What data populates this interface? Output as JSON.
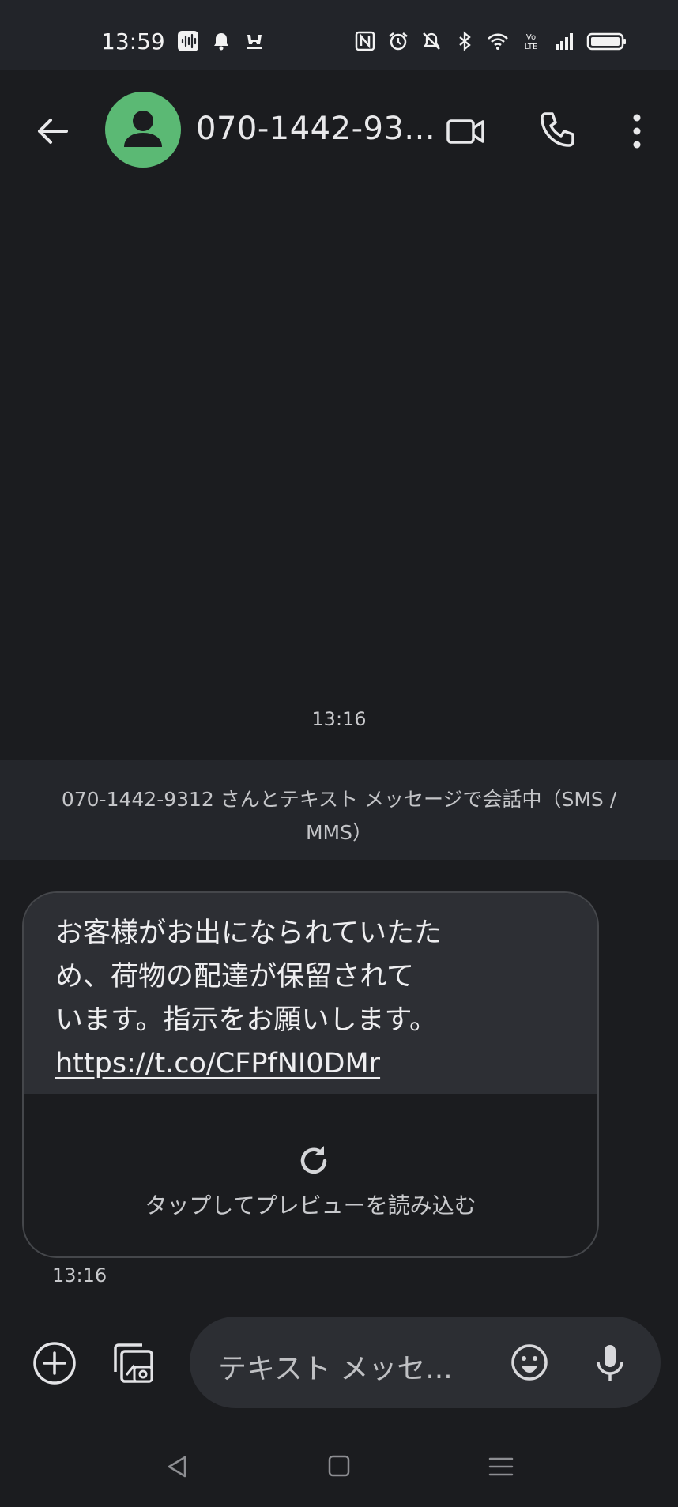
{
  "status_bar": {
    "time": "13:59",
    "left_icons": [
      "audio-app-icon",
      "notification-bell-icon",
      "honda-icon"
    ],
    "right_icons": [
      "nfc-icon",
      "alarm-icon",
      "mute-icon",
      "bluetooth-icon",
      "wifi-icon",
      "volte-icon",
      "signal-icon",
      "battery-icon"
    ]
  },
  "app_bar": {
    "contact_name": "070-1442-93...",
    "avatar_color": "#5bb974",
    "actions": [
      "video-call-icon",
      "phone-call-icon",
      "more-vert-icon"
    ]
  },
  "conversation": {
    "timestamp": "13:16",
    "sms_banner_lines": [
      "070-1442-9312 さんとテキスト メッセージで会話中（SMS /",
      "MMS）"
    ],
    "message": {
      "lines": [
        "お客様がお出になられていたた",
        "め、荷物の配達が保留されて",
        "います。指示をお願いします。"
      ],
      "link": "https://t.co/CFPfNI0DMr",
      "preview_label": "タップしてプレビューを読み込む",
      "time": "13:16"
    }
  },
  "composer": {
    "placeholder": "テキスト メッセ..."
  },
  "colors": {
    "background": "#1b1c1f",
    "status_bar": "#222429",
    "bubble": "#2d2f34",
    "composer": "#2c2e33"
  }
}
